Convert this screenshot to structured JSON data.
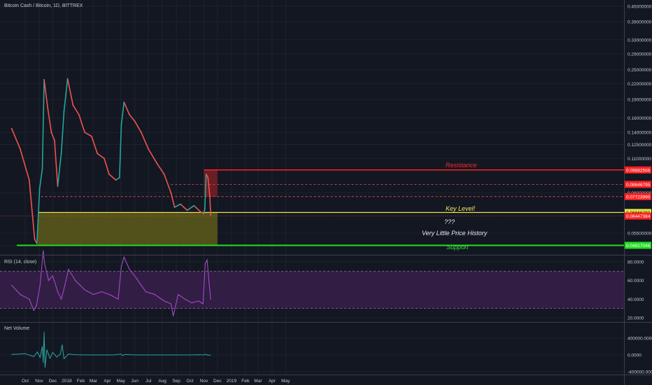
{
  "header": {
    "symbol_title": "Bitcoin Cash / Bitcoin, 1D, BITTREX"
  },
  "panes": {
    "rsi_title": "RSI (14, close)",
    "volume_title": "Net Volume"
  },
  "colors": {
    "background": "#131722",
    "grid": "#1e222d",
    "up_candle": "#26a69a",
    "down_candle": "#ef5350",
    "resistance": "#ff2020",
    "support": "#22dd22",
    "key_level": "#e6e64a",
    "rsi_line": "#a24cc6",
    "rsi_band": "#3b1f4d",
    "volume_line": "#2aa3a0"
  },
  "annotations": {
    "resistance": "Resistance",
    "key_level": "Key Level!",
    "question": "???",
    "little_history": "Very Little Price History",
    "support": "Support"
  },
  "chart_data": [
    {
      "type": "line",
      "title": "Bitcoin Cash / Bitcoin, 1D, BITTREX",
      "y_scale": "log",
      "y_tick_labels": [
        "0.45000000",
        "0.39000000",
        "0.33000000",
        "0.29000000",
        "0.25000000",
        "0.22000000",
        "0.19000000",
        "0.16000000",
        "0.14000000",
        "0.12500000",
        "0.11000000",
        "0.08000000",
        "0.05500000",
        "0.04900000"
      ],
      "y_tick_values": [
        0.45,
        0.39,
        0.33,
        0.29,
        0.25,
        0.22,
        0.19,
        0.16,
        0.14,
        0.125,
        0.11,
        0.08,
        0.055,
        0.049
      ],
      "x_tick_labels": [
        "Oct",
        "Nov",
        "Dec",
        "2018",
        "Feb",
        "Mar",
        "Apr",
        "May",
        "Jun",
        "Jul",
        "Aug",
        "Sep",
        "Oct",
        "Nov",
        "Dec",
        "2019",
        "Feb",
        "Mar",
        "Apr",
        "May"
      ],
      "x_tick_dates": [
        "2017-10-01",
        "2017-11-01",
        "2017-12-01",
        "2018-01-01",
        "2018-02-01",
        "2018-03-01",
        "2018-04-01",
        "2018-05-01",
        "2018-06-01",
        "2018-07-01",
        "2018-08-01",
        "2018-09-01",
        "2018-10-01",
        "2018-11-01",
        "2018-12-01",
        "2019-01-01",
        "2019-02-01",
        "2019-03-01",
        "2019-04-01",
        "2019-05-01"
      ],
      "price_labels": [
        {
          "text": "0.09882566",
          "value": 0.09883,
          "bg": "#ff2020",
          "fg": "#ffffff"
        },
        {
          "text": "0.08646795",
          "value": 0.08647,
          "bg": "#ff2020",
          "fg": "#ffffff"
        },
        {
          "text": "0.07723990",
          "value": 0.07724,
          "bg": "#ff2020",
          "fg": "#ffffff"
        },
        {
          "text": "0.06666283",
          "value": 0.06666,
          "bg": "#e6e64a",
          "fg": "#000000"
        },
        {
          "text": "0.06447384",
          "value": 0.06447,
          "bg": "#ff2020",
          "fg": "#ffffff"
        },
        {
          "text": "0.04917046",
          "value": 0.04917,
          "bg": "#22dd22",
          "fg": "#ffffff"
        }
      ],
      "levels": {
        "resistance": 0.09883,
        "dashed_upper": 0.08647,
        "dashed_lower": 0.07724,
        "key_level": 0.06666,
        "current": 0.06447,
        "support": 0.04917
      },
      "zones": [
        {
          "name": "resistance-zone",
          "from_date": "2018-11-01",
          "to_date": "2018-12-01",
          "low": 0.0771,
          "high": 0.0988,
          "color": "#7a1f25"
        },
        {
          "name": "history-zone",
          "from_date": "2017-10-29",
          "to_date": "2018-12-01",
          "low": 0.0492,
          "high": 0.0667,
          "color": "#5e5b1a"
        }
      ],
      "series": [
        {
          "x": [
            "2017-09-01",
            "2017-09-20",
            "2017-10-10",
            "2017-10-22",
            "2017-10-27",
            "2017-11-02",
            "2017-11-08",
            "2017-11-12",
            "2017-11-20",
            "2017-11-28",
            "2017-12-05",
            "2017-12-12",
            "2017-12-20",
            "2017-12-26",
            "2018-01-03",
            "2018-01-15",
            "2018-01-28",
            "2018-02-10",
            "2018-02-25",
            "2018-03-10",
            "2018-03-25",
            "2018-04-05",
            "2018-04-20",
            "2018-04-28",
            "2018-05-02",
            "2018-05-08",
            "2018-05-20",
            "2018-06-01",
            "2018-06-15",
            "2018-07-01",
            "2018-07-20",
            "2018-08-05",
            "2018-08-20",
            "2018-08-28",
            "2018-09-10",
            "2018-09-25",
            "2018-10-10",
            "2018-10-25",
            "2018-11-01",
            "2018-11-03",
            "2018-11-06",
            "2018-11-10",
            "2018-11-14",
            "2018-11-16"
          ],
          "y": [
            0.145,
            0.12,
            0.09,
            0.052,
            0.05,
            0.083,
            0.1,
            0.228,
            0.175,
            0.14,
            0.13,
            0.085,
            0.115,
            0.17,
            0.23,
            0.18,
            0.165,
            0.14,
            0.135,
            0.115,
            0.11,
            0.095,
            0.09,
            0.092,
            0.15,
            0.185,
            0.165,
            0.155,
            0.14,
            0.12,
            0.105,
            0.095,
            0.08,
            0.07,
            0.072,
            0.068,
            0.071,
            0.067,
            0.066,
            0.069,
            0.095,
            0.092,
            0.078,
            0.065
          ]
        }
      ]
    },
    {
      "type": "line",
      "title": "RSI (14, close)",
      "y_tick_labels": [
        "80.0000",
        "60.0000",
        "40.0000",
        "20.0000"
      ],
      "y_tick_values": [
        80,
        60,
        40,
        20
      ],
      "ylim": [
        17,
        90
      ],
      "bands": {
        "upper": 70,
        "lower": 30
      },
      "series": [
        {
          "x": [
            "2017-09-01",
            "2017-09-20",
            "2017-10-10",
            "2017-10-20",
            "2017-10-26",
            "2017-11-03",
            "2017-11-10",
            "2017-11-13",
            "2017-11-22",
            "2017-12-01",
            "2017-12-12",
            "2017-12-20",
            "2017-12-28",
            "2018-01-05",
            "2018-01-20",
            "2018-02-10",
            "2018-03-01",
            "2018-03-20",
            "2018-04-10",
            "2018-04-25",
            "2018-05-02",
            "2018-05-08",
            "2018-05-20",
            "2018-06-05",
            "2018-06-25",
            "2018-07-15",
            "2018-08-05",
            "2018-08-20",
            "2018-08-25",
            "2018-09-05",
            "2018-09-20",
            "2018-10-05",
            "2018-10-20",
            "2018-10-30",
            "2018-11-04",
            "2018-11-08",
            "2018-11-12",
            "2018-11-16"
          ],
          "y": [
            55,
            45,
            40,
            28,
            33,
            55,
            92,
            78,
            60,
            65,
            48,
            40,
            55,
            72,
            60,
            50,
            45,
            48,
            44,
            40,
            75,
            85,
            72,
            62,
            48,
            45,
            38,
            35,
            22,
            45,
            40,
            36,
            38,
            35,
            78,
            82,
            60,
            40
          ]
        }
      ]
    },
    {
      "type": "line",
      "title": "Net Volume",
      "y_tick_labels": [
        "400000.0000",
        "0.0000",
        "-400000.0000"
      ],
      "y_tick_values": [
        400000,
        0,
        -400000
      ],
      "ylim": [
        -450000,
        600000
      ],
      "series": [
        {
          "x": [
            "2017-09-01",
            "2017-10-01",
            "2017-10-20",
            "2017-10-28",
            "2017-11-03",
            "2017-11-08",
            "2017-11-10",
            "2017-11-12",
            "2017-11-14",
            "2017-11-18",
            "2017-11-25",
            "2017-12-01",
            "2017-12-10",
            "2017-12-18",
            "2017-12-22",
            "2017-12-26",
            "2018-01-05",
            "2018-01-20",
            "2018-02-15",
            "2018-03-15",
            "2018-04-15",
            "2018-05-01",
            "2018-05-05",
            "2018-05-10",
            "2018-06-01",
            "2018-07-01",
            "2018-08-01",
            "2018-09-01",
            "2018-10-01",
            "2018-10-20",
            "2018-11-01",
            "2018-11-05",
            "2018-11-10",
            "2018-11-16"
          ],
          "y": [
            10000,
            30000,
            -40000,
            70000,
            -60000,
            200000,
            -180000,
            540000,
            -300000,
            120000,
            -80000,
            60000,
            -50000,
            20000,
            240000,
            -90000,
            20000,
            5000,
            0,
            0,
            0,
            20000,
            -15000,
            10000,
            0,
            0,
            0,
            0,
            0,
            5000,
            0,
            15000,
            -10000,
            0
          ]
        }
      ]
    }
  ]
}
